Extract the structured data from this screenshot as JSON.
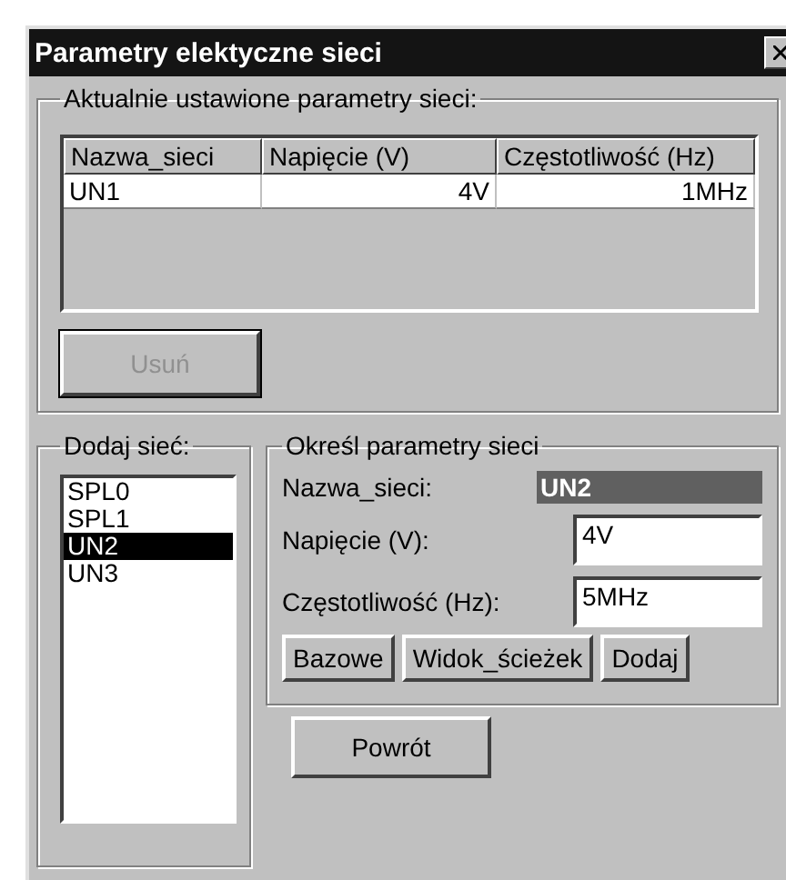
{
  "window": {
    "title": "Parametry elektyczne sieci"
  },
  "current_group": {
    "title": "Aktualnie ustawione parametry sieci:",
    "table": {
      "columns": [
        "Nazwa_sieci",
        "Napięcie (V)",
        "Częstotliwość (Hz)"
      ],
      "rows": [
        [
          "UN1",
          "4V",
          "1MHz"
        ]
      ]
    },
    "delete_button": {
      "label": "Usuń",
      "disabled": true
    }
  },
  "add_group": {
    "title": "Dodaj sieć:",
    "items": [
      {
        "label": "SPL0",
        "selected": false
      },
      {
        "label": "SPL1",
        "selected": false
      },
      {
        "label": "UN2",
        "selected": true
      },
      {
        "label": "UN3",
        "selected": false
      }
    ]
  },
  "params_group": {
    "title": "Określ parametry sieci",
    "name_label": "Nazwa_sieci:",
    "name_value": "UN2",
    "voltage_label": "Napięcie (V):",
    "voltage_value": "4V",
    "frequency_label": "Częstotliwość (Hz):",
    "frequency_value": "5MHz",
    "buttons": [
      "Bazowe",
      "Widok_ścieżek",
      "Dodaj"
    ]
  },
  "back_button": {
    "label": "Powrót"
  }
}
